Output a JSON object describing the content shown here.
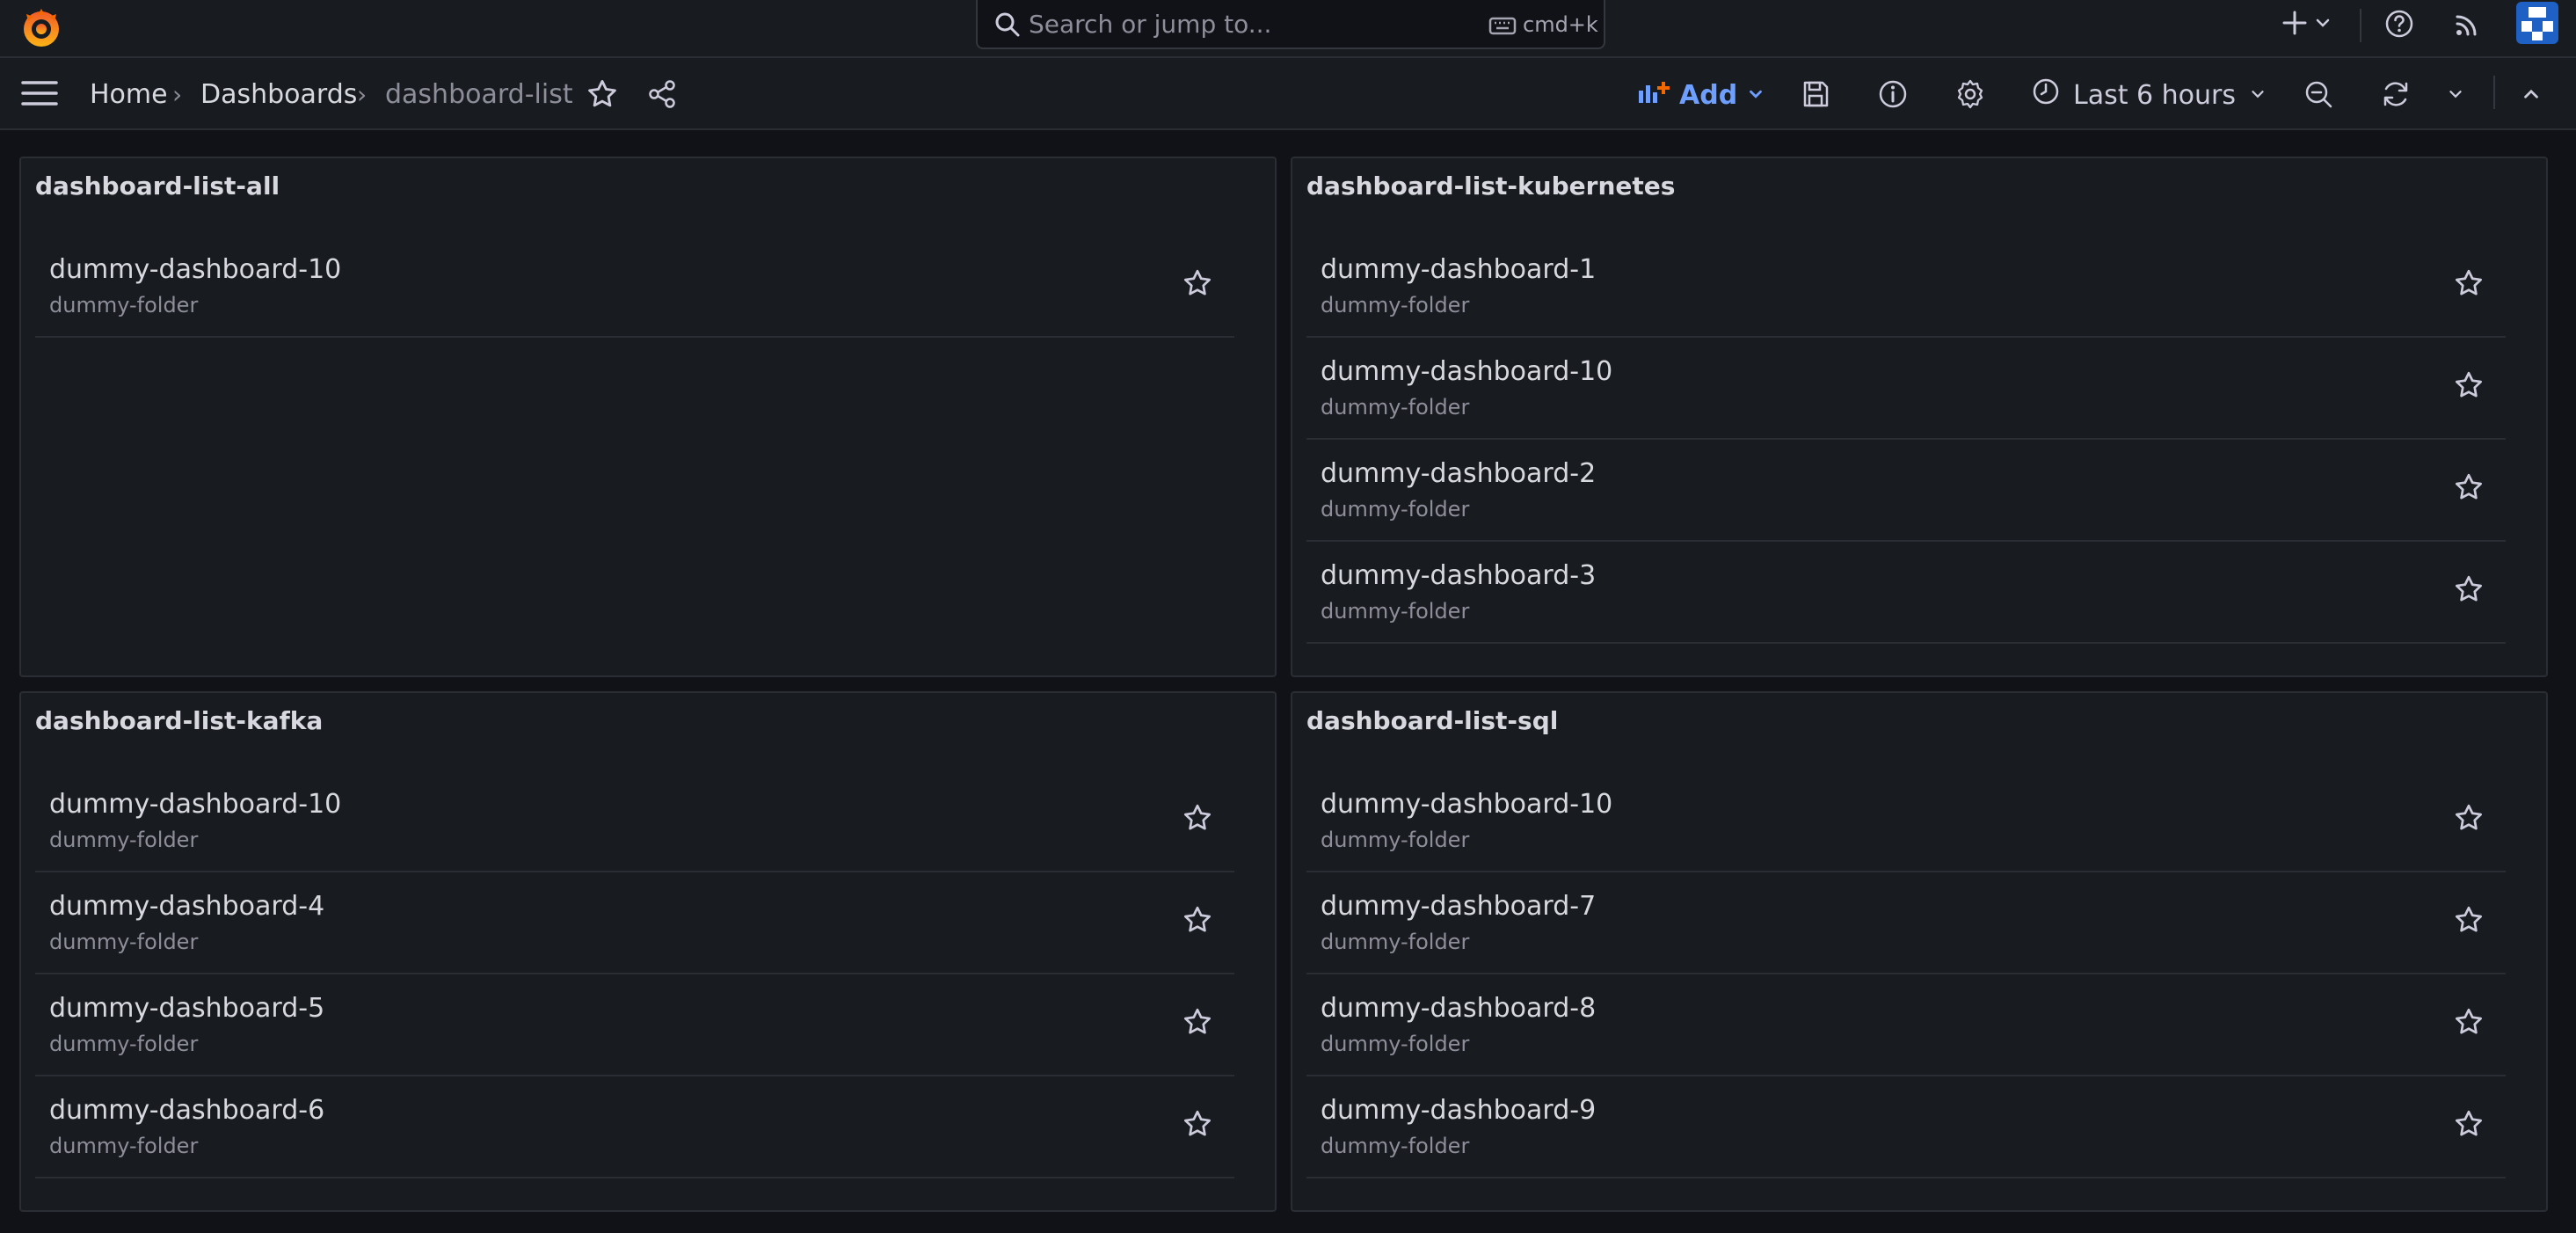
{
  "search": {
    "placeholder": "Search or jump to...",
    "shortcut": "cmd+k"
  },
  "breadcrumb": [
    "Home",
    "Dashboards",
    "dashboard-list"
  ],
  "toolbar": {
    "add_label": "Add",
    "time_range": "Last 6 hours"
  },
  "colors": {
    "accent": "#6e9fff",
    "grafana_orange": "#f46800",
    "background": "#111217",
    "panel": "#181b1f"
  },
  "panels": [
    {
      "title": "dashboard-list-all",
      "items": [
        {
          "title": "dummy-dashboard-10",
          "folder": "dummy-folder"
        }
      ]
    },
    {
      "title": "dashboard-list-kubernetes",
      "items": [
        {
          "title": "dummy-dashboard-1",
          "folder": "dummy-folder"
        },
        {
          "title": "dummy-dashboard-10",
          "folder": "dummy-folder"
        },
        {
          "title": "dummy-dashboard-2",
          "folder": "dummy-folder"
        },
        {
          "title": "dummy-dashboard-3",
          "folder": "dummy-folder"
        }
      ]
    },
    {
      "title": "dashboard-list-kafka",
      "items": [
        {
          "title": "dummy-dashboard-10",
          "folder": "dummy-folder"
        },
        {
          "title": "dummy-dashboard-4",
          "folder": "dummy-folder"
        },
        {
          "title": "dummy-dashboard-5",
          "folder": "dummy-folder"
        },
        {
          "title": "dummy-dashboard-6",
          "folder": "dummy-folder"
        }
      ]
    },
    {
      "title": "dashboard-list-sql",
      "items": [
        {
          "title": "dummy-dashboard-10",
          "folder": "dummy-folder"
        },
        {
          "title": "dummy-dashboard-7",
          "folder": "dummy-folder"
        },
        {
          "title": "dummy-dashboard-8",
          "folder": "dummy-folder"
        },
        {
          "title": "dummy-dashboard-9",
          "folder": "dummy-folder"
        }
      ]
    }
  ]
}
